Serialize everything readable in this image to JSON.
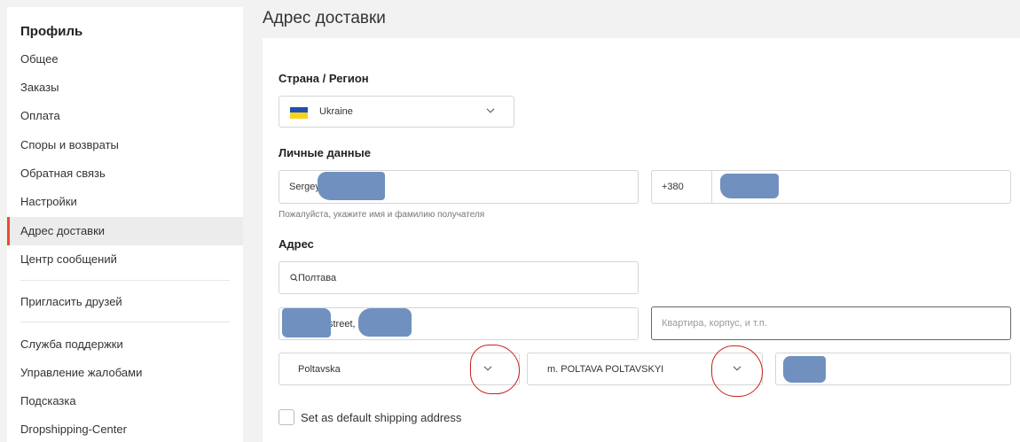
{
  "sidebar": {
    "title": "Профиль",
    "items": [
      {
        "label": "Общее"
      },
      {
        "label": "Заказы"
      },
      {
        "label": "Оплата"
      },
      {
        "label": "Споры и возвраты"
      },
      {
        "label": "Обратная связь"
      },
      {
        "label": "Настройки"
      },
      {
        "label": "Адрес доставки",
        "active": true
      },
      {
        "label": "Центр сообщений"
      },
      {
        "label": "Пригласить друзей"
      },
      {
        "label": "Служба поддержки"
      },
      {
        "label": "Управление жалобами"
      },
      {
        "label": "Подсказка"
      },
      {
        "label": "Dropshipping-Center"
      }
    ],
    "accent_color": "#e84c2b"
  },
  "page": {
    "title": "Адрес доставки"
  },
  "form": {
    "country_label": "Страна / Регион",
    "country_value": "Ukraine",
    "personal_label": "Личные данные",
    "name_value": "Sergey",
    "phone_prefix": "+380",
    "name_hint": "Пожалуйста, укажите имя и фамилию получателя",
    "address_label": "Адрес",
    "city_search_value": "Полтава",
    "street_value": "street,",
    "apartment_placeholder": "Квартира, корпус, и т.п.",
    "region_value": "Poltavska",
    "city_value": "m. POLTAVA POLTAVSKYI",
    "default_checkbox_label": "Set as default shipping address",
    "default_checked": false
  },
  "colors": {
    "redaction": "#7091bf",
    "annotation": "#c8221f"
  }
}
